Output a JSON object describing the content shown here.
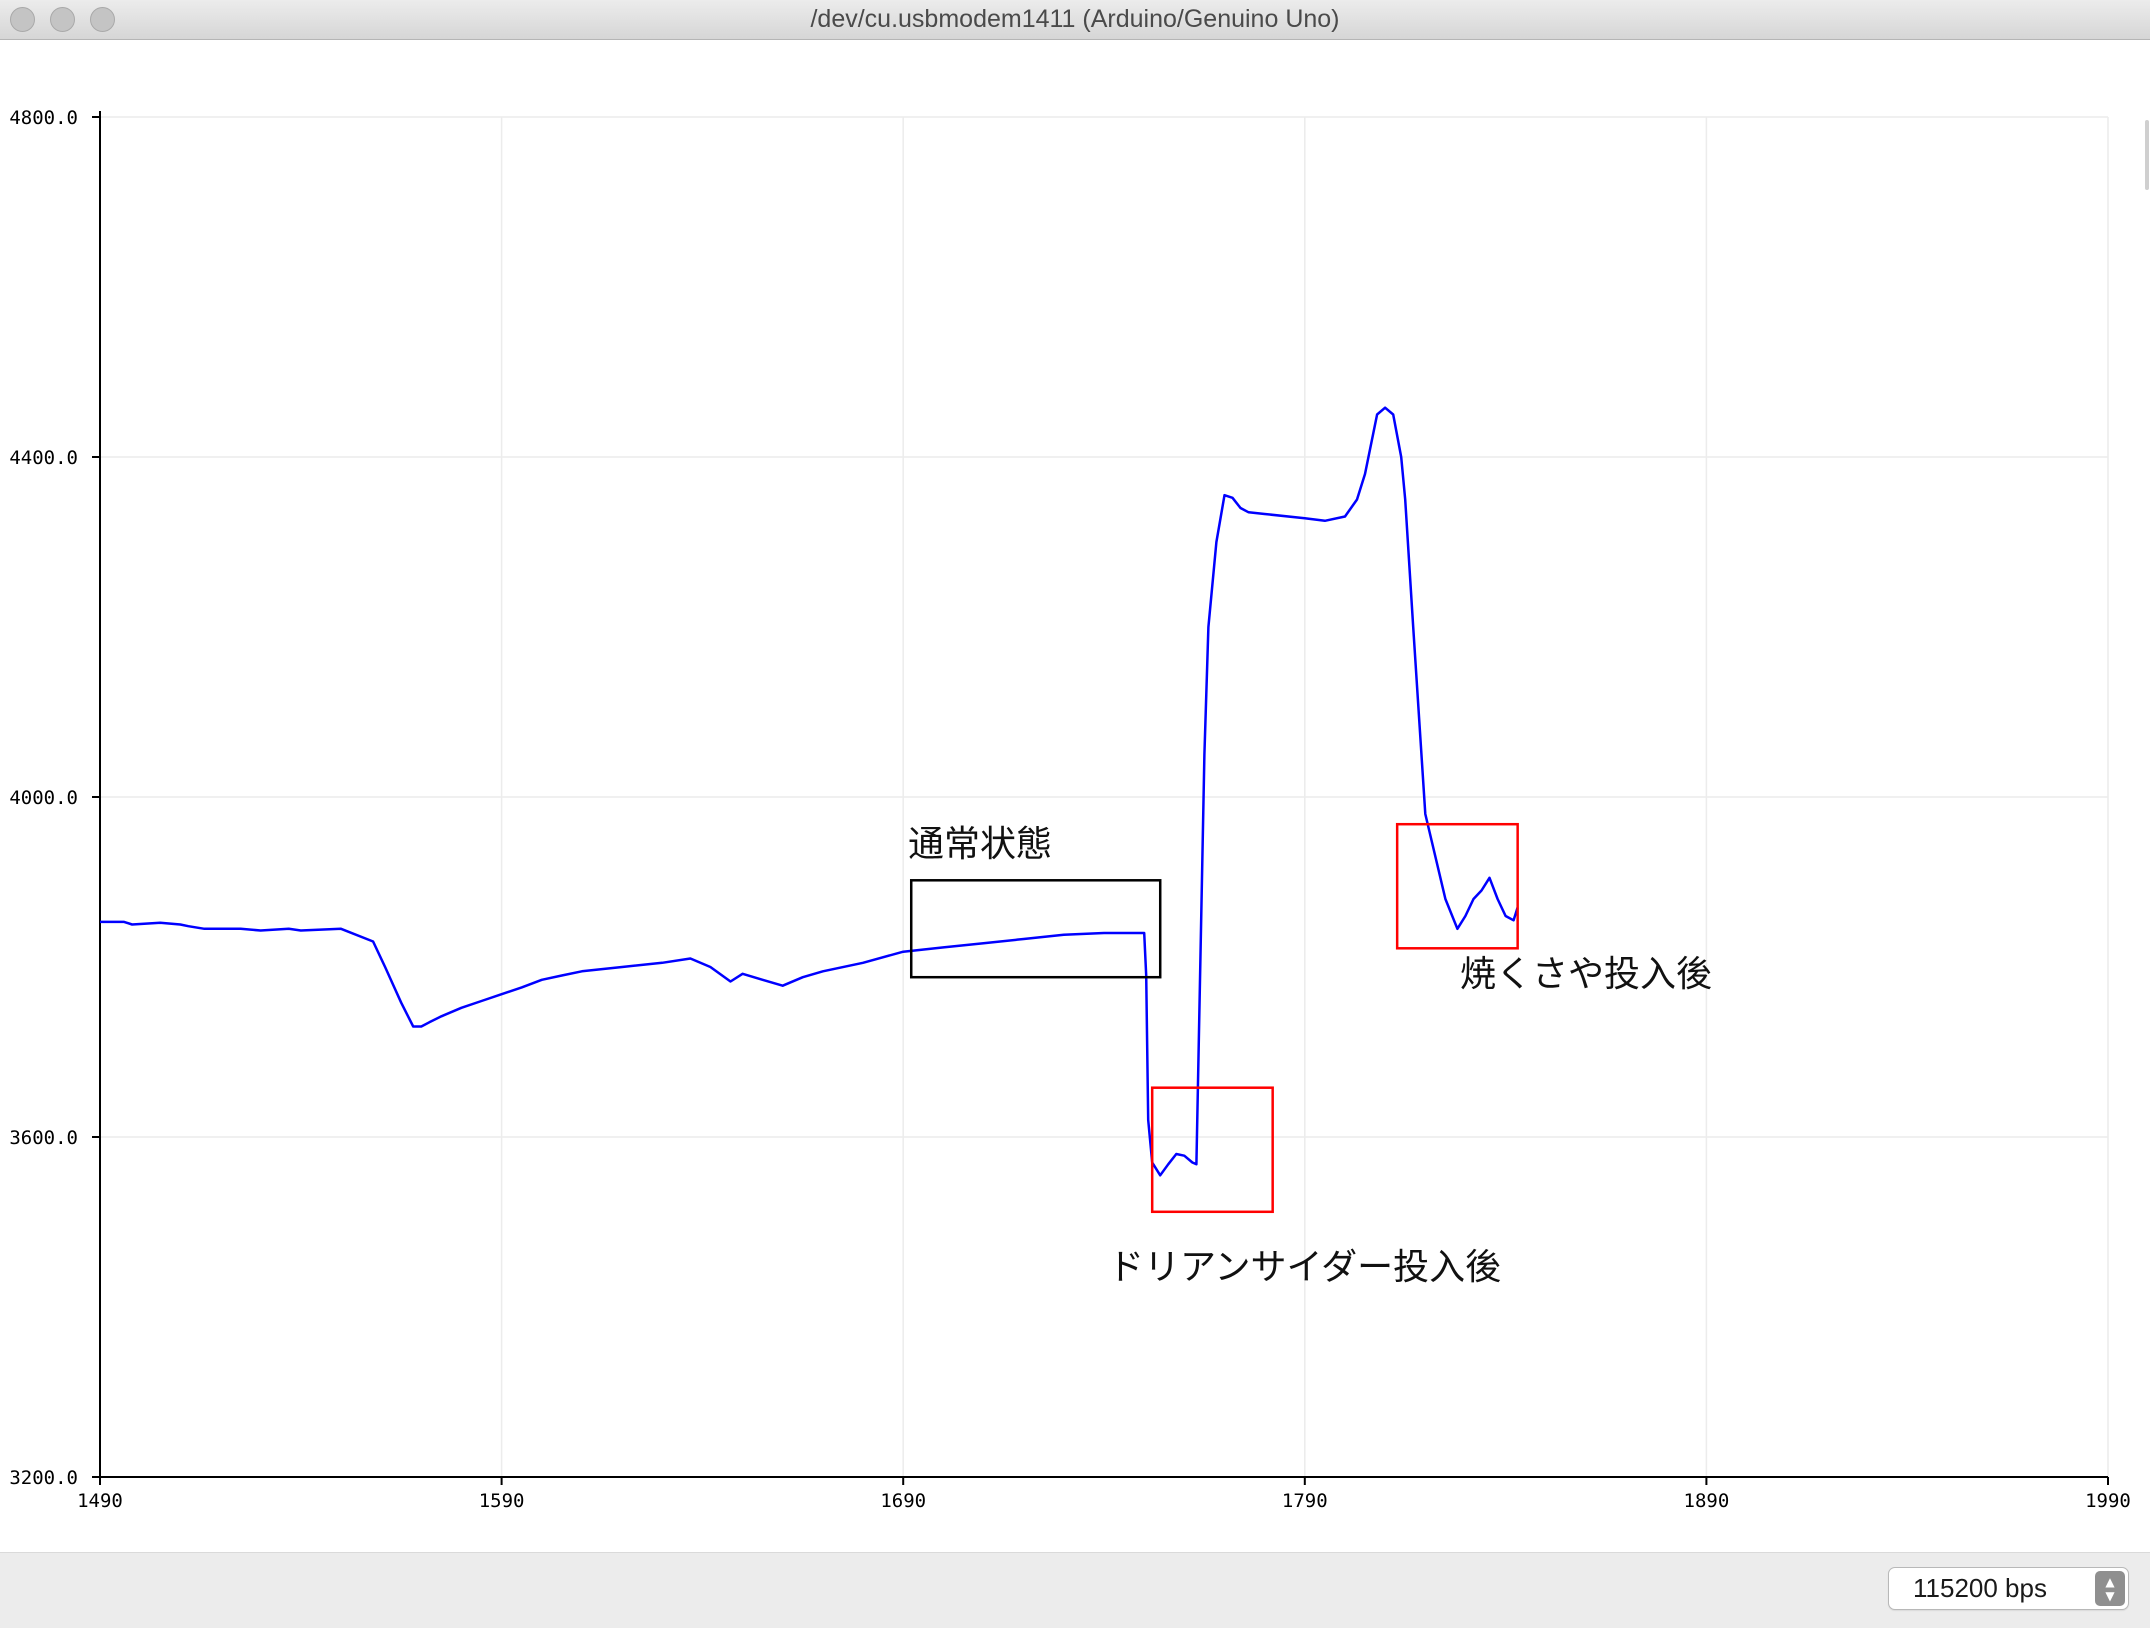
{
  "window": {
    "title": "/dev/cu.usbmodem1411 (Arduino/Genuino Uno)"
  },
  "bottom_bar": {
    "baud_rate": "115200 bps"
  },
  "colors": {
    "series": "#0000ff",
    "grid": "#ececec",
    "annotation_black": "#000000",
    "annotation_red": "#ff0000"
  },
  "chart_data": {
    "type": "line",
    "xlim": [
      1490,
      1990
    ],
    "ylim": [
      3200.0,
      4800.0
    ],
    "x_ticks": [
      "1490",
      "1590",
      "1690",
      "1790",
      "1890",
      "1990"
    ],
    "y_ticks": [
      "3200.0",
      "3600.0",
      "4000.0",
      "4400.0",
      "4800.0"
    ],
    "grid": true,
    "series": [
      {
        "color": "#0000ff",
        "x": [
          1490,
          1496,
          1498,
          1505,
          1510,
          1512,
          1516,
          1525,
          1530,
          1537,
          1540,
          1550,
          1558,
          1561,
          1565,
          1568,
          1570,
          1572,
          1575,
          1580,
          1585,
          1590,
          1595,
          1600,
          1605,
          1610,
          1620,
          1630,
          1637,
          1642,
          1647,
          1650,
          1655,
          1660,
          1665,
          1670,
          1680,
          1690,
          1700,
          1710,
          1720,
          1730,
          1740,
          1750,
          1750.5,
          1751,
          1752,
          1754,
          1756,
          1758,
          1760,
          1762,
          1763,
          1765,
          1766,
          1768,
          1770,
          1772,
          1774,
          1776,
          1780,
          1790,
          1795,
          1800,
          1803,
          1805,
          1808,
          1810,
          1812,
          1814,
          1815,
          1817,
          1820,
          1825,
          1828,
          1830,
          1832,
          1834,
          1836,
          1838,
          1840,
          1842,
          1843
        ],
        "values": [
          3853,
          3853,
          3850,
          3852,
          3850,
          3848,
          3845,
          3845,
          3843,
          3845,
          3843,
          3845,
          3830,
          3800,
          3758,
          3730,
          3730,
          3735,
          3742,
          3752,
          3760,
          3768,
          3776,
          3785,
          3790,
          3795,
          3800,
          3805,
          3810,
          3800,
          3783,
          3792,
          3785,
          3778,
          3788,
          3795,
          3805,
          3818,
          3823,
          3828,
          3833,
          3838,
          3840,
          3840,
          3790,
          3620,
          3570,
          3555,
          3568,
          3580,
          3578,
          3570,
          3568,
          4050,
          4200,
          4300,
          4355,
          4352,
          4340,
          4335,
          4333,
          4328,
          4325,
          4330,
          4350,
          4380,
          4450,
          4458,
          4450,
          4400,
          4350,
          4200,
          3980,
          3880,
          3845,
          3860,
          3880,
          3890,
          3905,
          3880,
          3860,
          3855,
          3870
        ]
      }
    ],
    "annotations": [
      {
        "label": "通常状態",
        "color": "#000000"
      },
      {
        "label": "ドリアンサイダー投入後",
        "color": "#ff0000"
      },
      {
        "label": "焼くさや投入後",
        "color": "#ff0000"
      }
    ]
  }
}
